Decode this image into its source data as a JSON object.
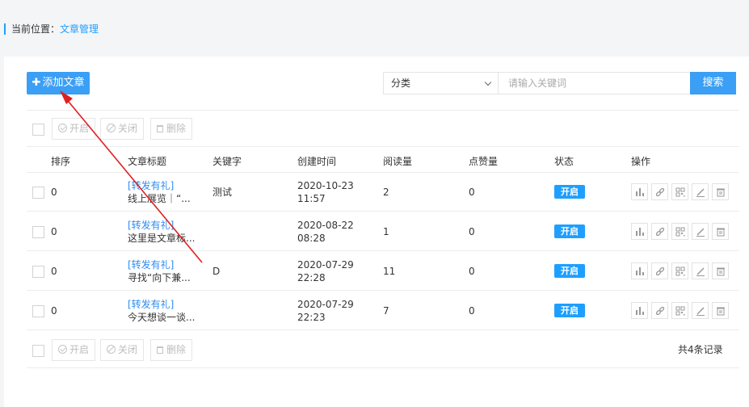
{
  "breadcrumb": {
    "prefix": "当前位置：",
    "current": "文章管理"
  },
  "toolbar": {
    "add_label": "添加文章",
    "category_select": "分类",
    "search_placeholder": "请输入关键词",
    "search_label": "搜索"
  },
  "bulk_actions": {
    "enable": "开启",
    "disable": "关闭",
    "delete": "删除"
  },
  "table": {
    "headers": {
      "sort": "排序",
      "title": "文章标题",
      "keywords": "关键字",
      "created": "创建时间",
      "reads": "阅读量",
      "likes": "点赞量",
      "status": "状态",
      "actions": "操作"
    },
    "rows": [
      {
        "sort": "0",
        "tag": "[转发有礼]",
        "title": "线上展览｜“...",
        "keywords": "测试",
        "date": "2020-10-23",
        "time": "11:57",
        "reads": "2",
        "likes": "0",
        "status": "开启"
      },
      {
        "sort": "0",
        "tag": "[转发有礼]",
        "title": "这里是文章标...",
        "keywords": "",
        "date": "2020-08-22",
        "time": "08:28",
        "reads": "1",
        "likes": "0",
        "status": "开启"
      },
      {
        "sort": "0",
        "tag": "[转发有礼]",
        "title": "寻找“向下兼...",
        "keywords": "D",
        "date": "2020-07-29",
        "time": "22:28",
        "reads": "11",
        "likes": "0",
        "status": "开启"
      },
      {
        "sort": "0",
        "tag": "[转发有礼]",
        "title": "今天想谈一谈...",
        "keywords": "",
        "date": "2020-07-29",
        "time": "22:23",
        "reads": "7",
        "likes": "0",
        "status": "开启"
      }
    ]
  },
  "footer": {
    "record_count": "共4条记录"
  },
  "colors": {
    "accent": "#1e9fff",
    "button": "#3a9ff5",
    "annotation_arrow": "#e02020"
  },
  "icons": [
    "bar-chart-icon",
    "link-icon",
    "qrcode-icon",
    "edit-icon",
    "trash-icon"
  ]
}
